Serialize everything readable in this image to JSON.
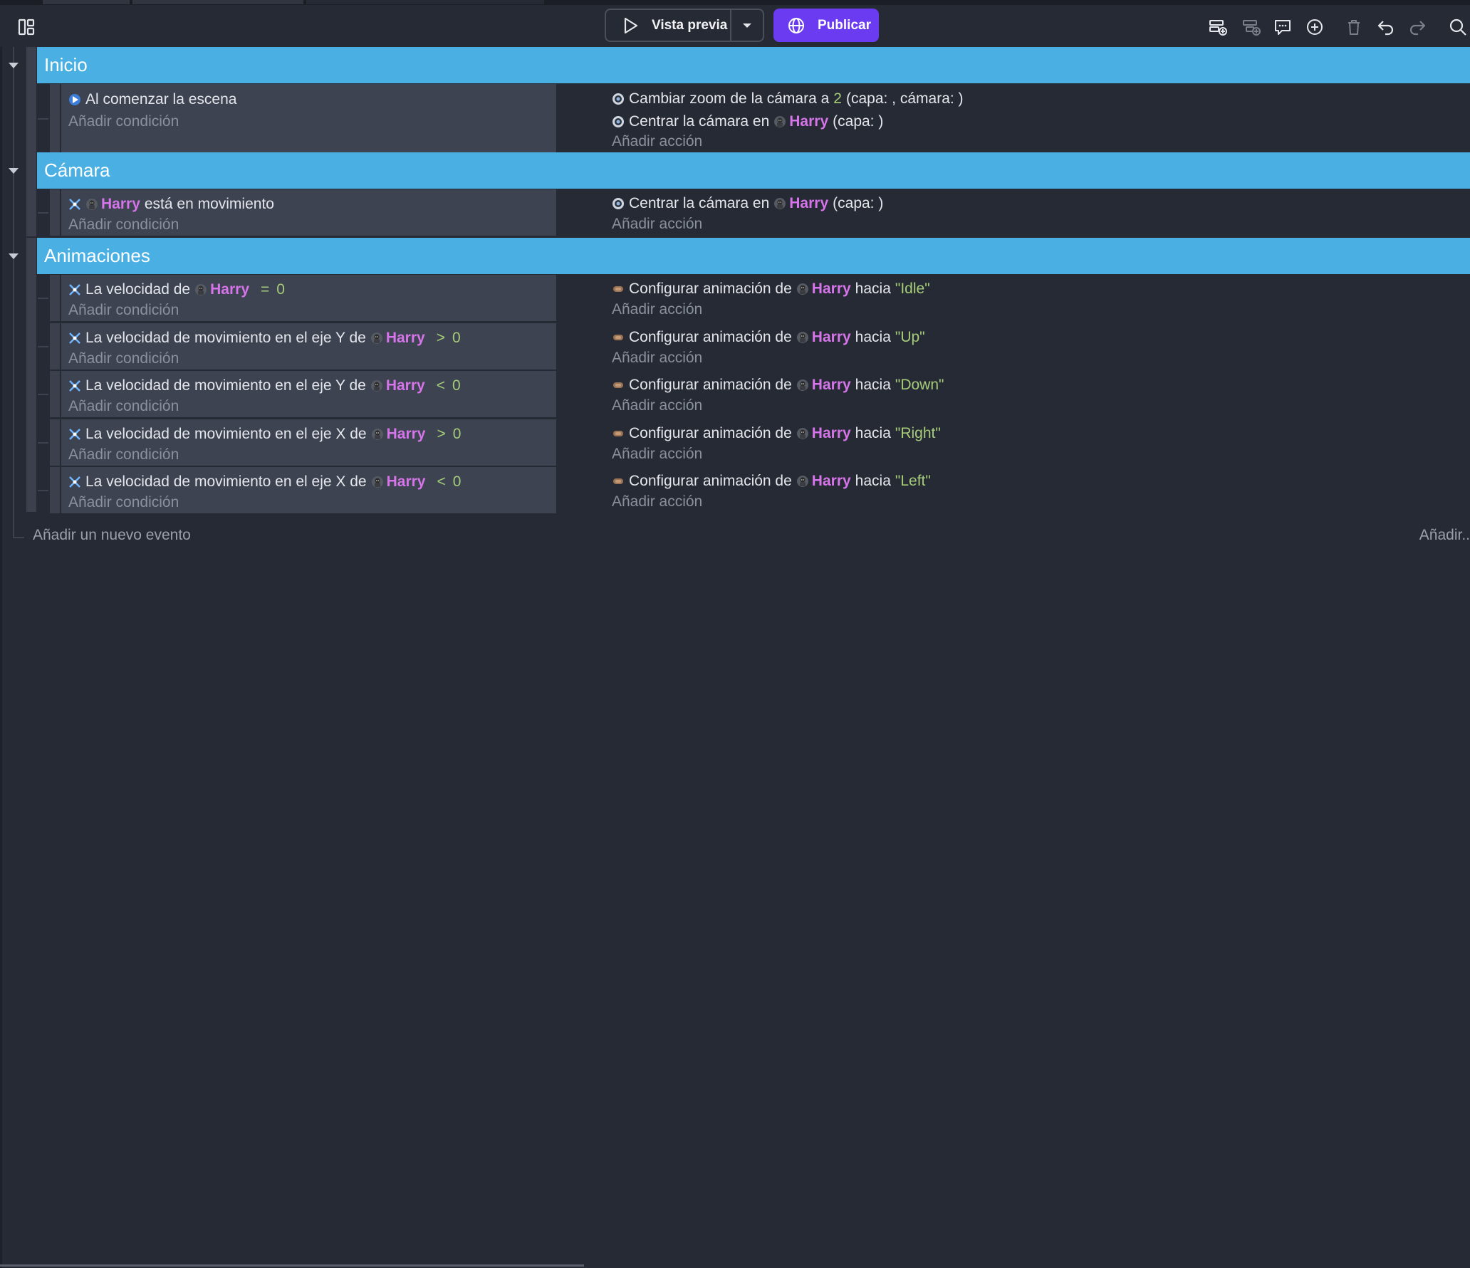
{
  "toolbar": {
    "preview_label": "Vista previa",
    "publish_label": "Publicar"
  },
  "colors": {
    "group_header": "#4ab0e4",
    "publish": "#6a3bf0",
    "object_name": "#d674e9",
    "value": "#a6cc7a",
    "background": "#262a34",
    "condition_panel": "#3d4351"
  },
  "common": {
    "add_condition": "Añadir condición",
    "add_action": "Añadir acción",
    "add_event": "Añadir un nuevo evento",
    "add_more": "Añadir..",
    "object": "Harry"
  },
  "groups": [
    {
      "title": "Inicio",
      "events": [
        {
          "conditions": [
            {
              "text": "Al comenzar la escena",
              "icon": "scene-start-icon"
            }
          ],
          "actions": [
            {
              "before": "Cambiar zoom de la cámara a",
              "value": "2",
              "after": "(capa: , cámara: )",
              "icon": "camera-icon"
            },
            {
              "before": "Centrar la cámara en",
              "object": "Harry",
              "after": "(capa: )",
              "icon": "camera-icon"
            }
          ]
        }
      ]
    },
    {
      "title": "Cámara",
      "events": [
        {
          "conditions": [
            {
              "object": "Harry",
              "after": "está en movimiento",
              "icon": "movement-icon"
            }
          ],
          "actions": [
            {
              "before": "Centrar la cámara en",
              "object": "Harry",
              "after": "(capa: )",
              "icon": "camera-icon"
            }
          ]
        }
      ]
    },
    {
      "title": "Animaciones",
      "events": [
        {
          "conditions": [
            {
              "before": "La velocidad de",
              "object": "Harry",
              "op": "=",
              "value": "0",
              "icon": "movement-icon"
            }
          ],
          "actions": [
            {
              "before": "Configurar animación de",
              "object": "Harry",
              "mid": "hacia",
              "value": "\"Idle\"",
              "icon": "animation-icon"
            }
          ]
        },
        {
          "conditions": [
            {
              "before": "La velocidad de movimiento en el eje Y de",
              "object": "Harry",
              "op": ">",
              "value": "0",
              "icon": "movement-icon"
            }
          ],
          "actions": [
            {
              "before": "Configurar animación de",
              "object": "Harry",
              "mid": "hacia",
              "value": "\"Up\"",
              "icon": "animation-icon"
            }
          ]
        },
        {
          "conditions": [
            {
              "before": "La velocidad de movimiento en el eje Y de",
              "object": "Harry",
              "op": "<",
              "value": "0",
              "icon": "movement-icon"
            }
          ],
          "actions": [
            {
              "before": "Configurar animación de",
              "object": "Harry",
              "mid": "hacia",
              "value": "\"Down\"",
              "icon": "animation-icon"
            }
          ]
        },
        {
          "conditions": [
            {
              "before": "La velocidad de movimiento en el eje X de",
              "object": "Harry",
              "op": ">",
              "value": "0",
              "icon": "movement-icon"
            }
          ],
          "actions": [
            {
              "before": "Configurar animación de",
              "object": "Harry",
              "mid": "hacia",
              "value": "\"Right\"",
              "icon": "animation-icon"
            }
          ]
        },
        {
          "conditions": [
            {
              "before": "La velocidad de movimiento en el eje X de",
              "object": "Harry",
              "op": "<",
              "value": "0",
              "icon": "movement-icon"
            }
          ],
          "actions": [
            {
              "before": "Configurar animación de",
              "object": "Harry",
              "mid": "hacia",
              "value": "\"Left\"",
              "icon": "animation-icon"
            }
          ]
        }
      ]
    }
  ]
}
